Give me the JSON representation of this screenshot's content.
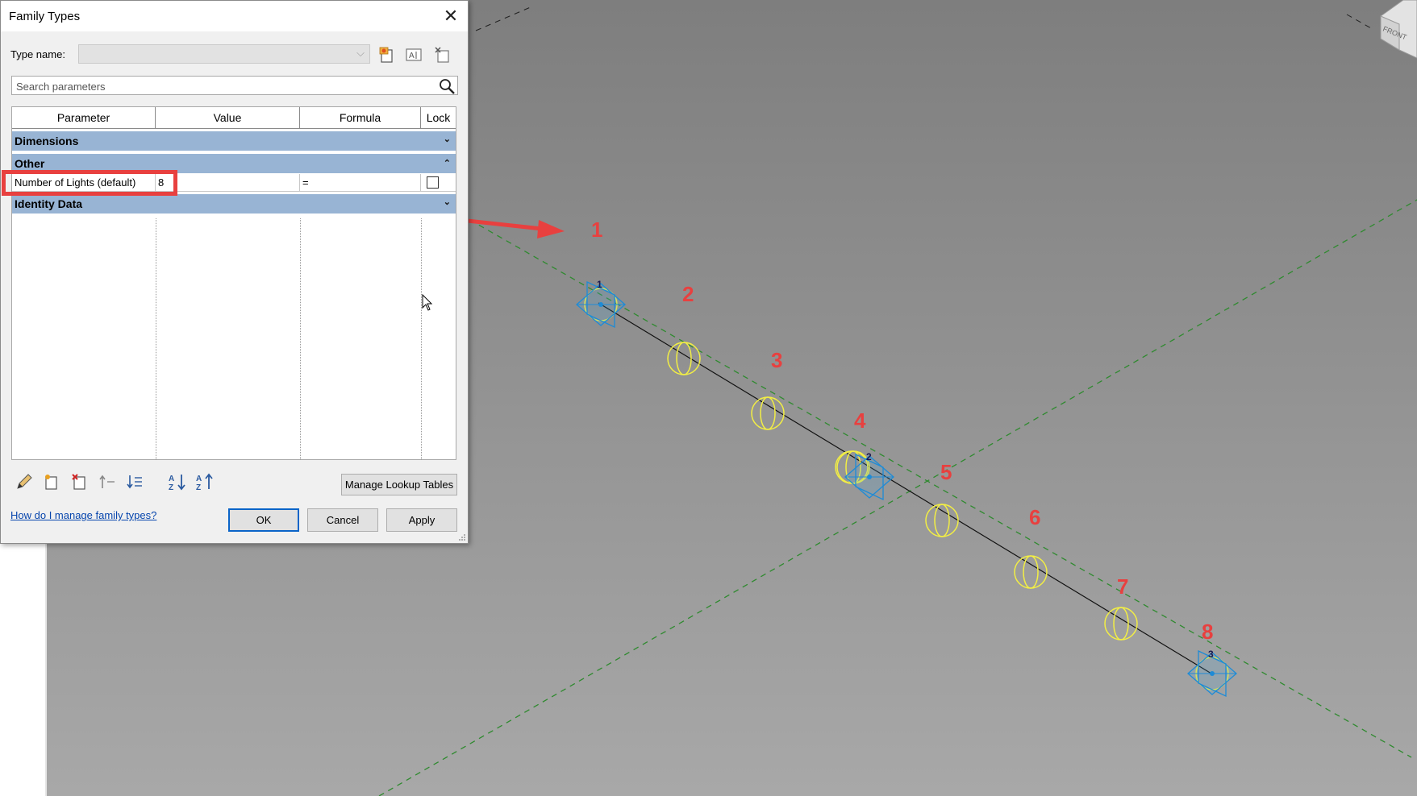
{
  "dialog": {
    "title": "Family Types",
    "type_name_label": "Type name:",
    "type_name_value": "",
    "search_placeholder": "Search parameters",
    "columns": [
      "Parameter",
      "Value",
      "Formula",
      "Lock"
    ],
    "groups": {
      "dimensions": "Dimensions",
      "other": "Other",
      "identity": "Identity Data"
    },
    "row": {
      "parameter": "Number of Lights (default)",
      "value": "8",
      "formula": "=",
      "lock": false
    },
    "manage_lookup": "Manage Lookup Tables",
    "help_link": "How do I manage family types?",
    "ok": "OK",
    "cancel": "Cancel",
    "apply": "Apply"
  },
  "viewport": {
    "annotations": [
      "1",
      "2",
      "3",
      "4",
      "5",
      "6",
      "7",
      "8"
    ],
    "node_labels": [
      "1",
      "2",
      "3"
    ],
    "viewcube_label": "FRONT",
    "colors": {
      "background_top": "#7e7e7e",
      "background_bottom": "#a6a6a6",
      "annotation": "#e8403f",
      "reference_plane": "#2f8a2f",
      "light_fixture": "#f2ee44",
      "reference_point": "#1e8bd6"
    }
  }
}
